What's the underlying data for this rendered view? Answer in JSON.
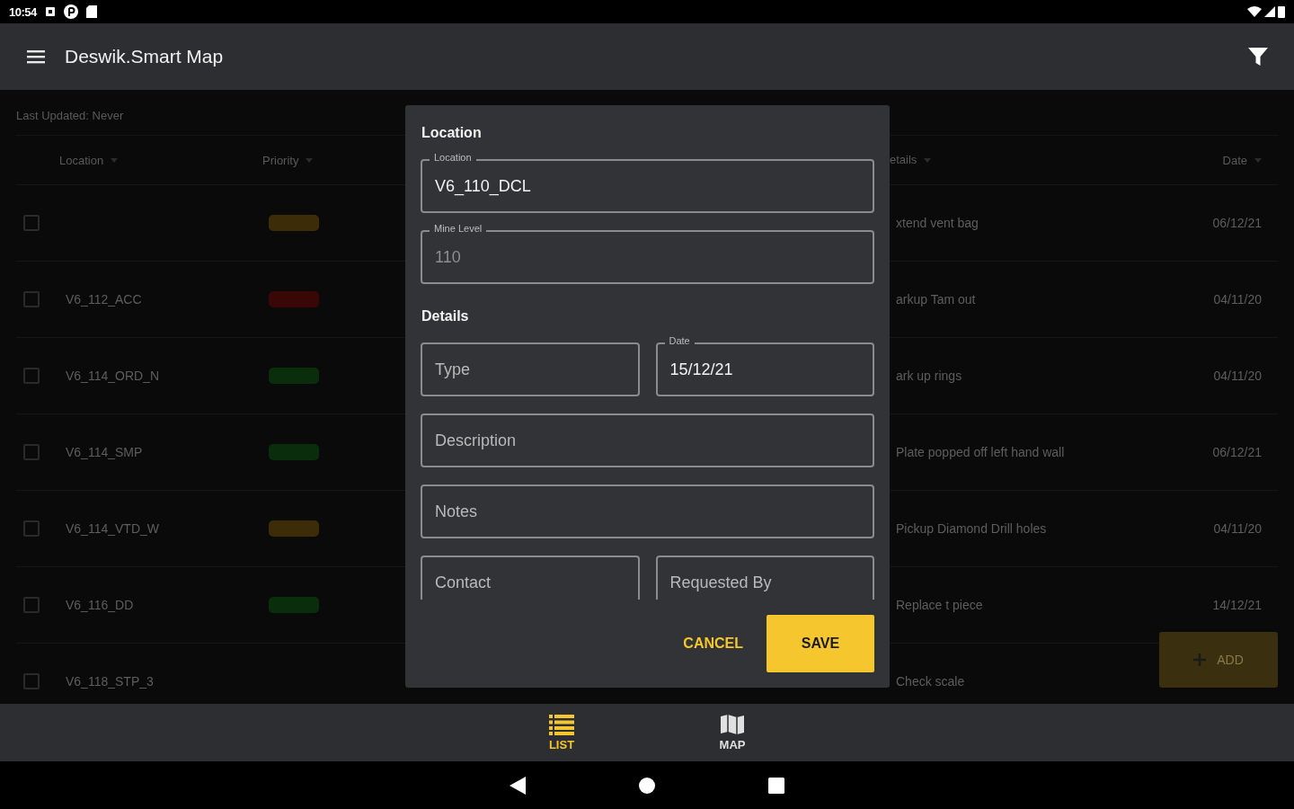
{
  "status_bar": {
    "time": "10:54"
  },
  "app_bar": {
    "title": "Deswik.Smart Map"
  },
  "table": {
    "last_updated": "Last Updated: Never",
    "columns": [
      {
        "label": "Location"
      },
      {
        "label": "Priority"
      },
      {
        "label": "etails"
      },
      {
        "label": "Date"
      }
    ],
    "rows": [
      {
        "checked": false,
        "color": "#3d2c08",
        "details": "xtend vent bag",
        "date": "06/12/21"
      },
      {
        "checked": false,
        "location": "V6_112_ACC",
        "color": "#3a0707",
        "details": "arkup Tam out",
        "date": "04/11/20"
      },
      {
        "checked": false,
        "location": "V6_114_ORD_N",
        "color": "#0a2e0c",
        "details": "ark up rings",
        "date": "04/11/20"
      },
      {
        "checked": false,
        "location": "V6_114_SMP",
        "color": "#0a2e0c",
        "details": "Plate popped off left hand wall",
        "date": "06/12/21"
      },
      {
        "checked": false,
        "location": "V6_114_VTD_W",
        "color": "#3d2c08",
        "details": "Pickup Diamond Drill holes",
        "date": "04/11/20"
      },
      {
        "checked": false,
        "location": "V6_116_DD",
        "color": "#0a2e0c",
        "details": "Replace t piece",
        "date": "14/12/21"
      },
      {
        "checked": false,
        "location": "V6_118_STP_3",
        "details": "Check scale"
      }
    ]
  },
  "fab": {
    "label": "ADD"
  },
  "dialog": {
    "sections": [
      {
        "title": "Location",
        "rows": [
          [
            {
              "label": "Location",
              "value": "V6_110_DCL",
              "disabled": false
            }
          ],
          [
            {
              "label": "Mine Level",
              "value": "110",
              "disabled": true
            }
          ]
        ]
      },
      {
        "title": "Details",
        "rows": [
          [
            {
              "placeholder": "Type"
            },
            {
              "label": "Date",
              "value": "15/12/21",
              "disabled": false
            }
          ],
          [
            {
              "placeholder": "Description"
            }
          ],
          [
            {
              "placeholder": "Notes"
            }
          ],
          [
            {
              "placeholder": "Contact"
            },
            {
              "placeholder": "Requested By"
            }
          ]
        ]
      }
    ],
    "buttons": [
      {
        "label": "CANCEL",
        "kind": "text"
      },
      {
        "label": "SAVE",
        "kind": "filled"
      }
    ]
  },
  "bottom_nav": [
    {
      "label": "LIST",
      "kind": "list",
      "selected": true
    },
    {
      "label": "MAP",
      "kind": "map",
      "selected": false
    }
  ]
}
